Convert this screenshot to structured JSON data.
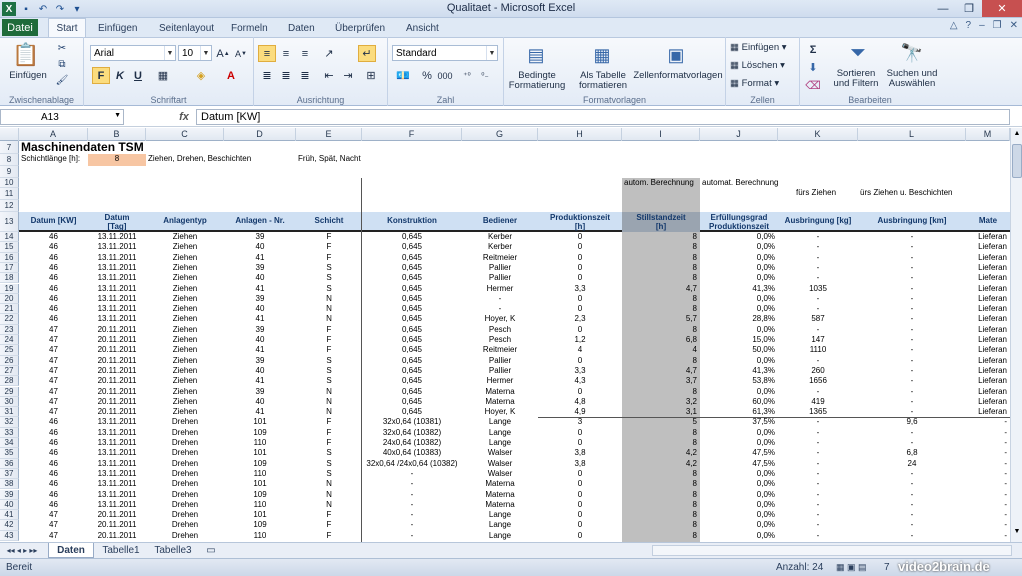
{
  "window": {
    "title": "Qualitaet - Microsoft Excel"
  },
  "tabs": {
    "file": "Datei",
    "start": "Start",
    "insert": "Einfügen",
    "layout": "Seitenlayout",
    "formulas": "Formeln",
    "data": "Daten",
    "review": "Überprüfen",
    "view": "Ansicht"
  },
  "ribbon": {
    "clipboard": {
      "paste": "Einfügen",
      "label": "Zwischenablage"
    },
    "font": {
      "name": "Arial",
      "size": "10",
      "label": "Schriftart",
      "bold": "F",
      "italic": "K",
      "underline": "U"
    },
    "alignment": {
      "label": "Ausrichtung"
    },
    "number": {
      "format": "Standard",
      "label": "Zahl",
      "percent": "%",
      "thousands": "000"
    },
    "styles": {
      "conditional1": "Bedingte",
      "conditional2": "Formatierung",
      "table1": "Als Tabelle",
      "table2": "formatieren",
      "cellstyles": "Zellenformatvorlagen",
      "label": "Formatvorlagen"
    },
    "cells": {
      "insert": "Einfügen",
      "delete": "Löschen",
      "format": "Format",
      "label": "Zellen"
    },
    "editing": {
      "sort1": "Sortieren",
      "sort2": "und Filtern",
      "find1": "Suchen und",
      "find2": "Auswählen",
      "label": "Bearbeiten"
    }
  },
  "formula": {
    "namebox": "A13",
    "fx": "fx",
    "value": "Datum [KW]"
  },
  "grid": {
    "columns": [
      "A",
      "B",
      "C",
      "D",
      "E",
      "F",
      "G",
      "H",
      "I",
      "J",
      "K",
      "L",
      "M"
    ],
    "row7": {
      "num": "7",
      "title": "Maschinendaten TSM"
    },
    "row8": {
      "num": "8",
      "label": "Schichtlänge [h]:",
      "value": "8",
      "processes": "Ziehen, Drehen, Beschichten",
      "shifts": "Früh, Spät, Nacht"
    },
    "row9": {
      "num": "9"
    },
    "row10": {
      "num": "10",
      "i": "autom. Berechnung",
      "j": "automat. Berechnung"
    },
    "row11": {
      "num": "11",
      "k": "fürs Ziehen",
      "l": "ürs Ziehen u. Beschichten"
    },
    "row12": {
      "num": "12"
    },
    "row13": {
      "num": "13",
      "a": "Datum [KW]",
      "b1": "Datum",
      "b2": "[Tag]",
      "c": "Anlagentyp",
      "d": "Anlagen - Nr.",
      "e": "Schicht",
      "f": "Konstruktion",
      "g": "Bediener",
      "h1": "Produktionszeit",
      "h2": "[h]",
      "i1": "Stillstandzeit",
      "i2": "[h]",
      "j1": "Erfüllungsgrad",
      "j2": "Produktionszeit",
      "k": "Ausbringung [kg]",
      "l": "Ausbringung [km]",
      "m": "Mate"
    },
    "rows": [
      [
        "14",
        "46",
        "13.11.2011",
        "Ziehen",
        "39",
        "F",
        "0,645",
        "Kerber",
        "0",
        "8",
        "0,0%",
        "-",
        "-",
        "Lieferan"
      ],
      [
        "15",
        "46",
        "13.11.2011",
        "Ziehen",
        "40",
        "F",
        "0,645",
        "Kerber",
        "0",
        "8",
        "0,0%",
        "-",
        "-",
        "Lieferan"
      ],
      [
        "16",
        "46",
        "13.11.2011",
        "Ziehen",
        "41",
        "F",
        "0,645",
        "Reitmeier",
        "0",
        "8",
        "0,0%",
        "-",
        "-",
        "Lieferan"
      ],
      [
        "17",
        "46",
        "13.11.2011",
        "Ziehen",
        "39",
        "S",
        "0,645",
        "Pallier",
        "0",
        "8",
        "0,0%",
        "-",
        "-",
        "Lieferan"
      ],
      [
        "18",
        "46",
        "13.11.2011",
        "Ziehen",
        "40",
        "S",
        "0,645",
        "Pallier",
        "0",
        "8",
        "0,0%",
        "-",
        "-",
        "Lieferan"
      ],
      [
        "19",
        "46",
        "13.11.2011",
        "Ziehen",
        "41",
        "S",
        "0,645",
        "Hermer",
        "3,3",
        "4,7",
        "41,3%",
        "1035",
        "-",
        "Lieferan"
      ],
      [
        "20",
        "46",
        "13.11.2011",
        "Ziehen",
        "39",
        "N",
        "0,645",
        "-",
        "0",
        "8",
        "0,0%",
        "-",
        "-",
        "Lieferan"
      ],
      [
        "21",
        "46",
        "13.11.2011",
        "Ziehen",
        "40",
        "N",
        "0,645",
        "-",
        "0",
        "8",
        "0,0%",
        "-",
        "-",
        "Lieferan"
      ],
      [
        "22",
        "46",
        "13.11.2011",
        "Ziehen",
        "41",
        "N",
        "0,645",
        "Hoyer, K",
        "2,3",
        "5,7",
        "28,8%",
        "587",
        "-",
        "Lieferan"
      ],
      [
        "23",
        "47",
        "20.11.2011",
        "Ziehen",
        "39",
        "F",
        "0,645",
        "Pesch",
        "0",
        "8",
        "0,0%",
        "-",
        "-",
        "Lieferan"
      ],
      [
        "24",
        "47",
        "20.11.2011",
        "Ziehen",
        "40",
        "F",
        "0,645",
        "Pesch",
        "1,2",
        "6,8",
        "15,0%",
        "147",
        "-",
        "Lieferan"
      ],
      [
        "25",
        "47",
        "20.11.2011",
        "Ziehen",
        "41",
        "F",
        "0,645",
        "Reitmeier",
        "4",
        "4",
        "50,0%",
        "1110",
        "-",
        "Lieferan"
      ],
      [
        "26",
        "47",
        "20.11.2011",
        "Ziehen",
        "39",
        "S",
        "0,645",
        "Pallier",
        "0",
        "8",
        "0,0%",
        "-",
        "-",
        "Lieferan"
      ],
      [
        "27",
        "47",
        "20.11.2011",
        "Ziehen",
        "40",
        "S",
        "0,645",
        "Pallier",
        "3,3",
        "4,7",
        "41,3%",
        "260",
        "-",
        "Lieferan"
      ],
      [
        "28",
        "47",
        "20.11.2011",
        "Ziehen",
        "41",
        "S",
        "0,645",
        "Hermer",
        "4,3",
        "3,7",
        "53,8%",
        "1656",
        "-",
        "Lieferan"
      ],
      [
        "29",
        "47",
        "20.11.2011",
        "Ziehen",
        "39",
        "N",
        "0,645",
        "Materna",
        "0",
        "8",
        "0,0%",
        "-",
        "-",
        "Lieferan"
      ],
      [
        "30",
        "47",
        "20.11.2011",
        "Ziehen",
        "40",
        "N",
        "0,645",
        "Materna",
        "4,8",
        "3,2",
        "60,0%",
        "419",
        "-",
        "Lieferan"
      ],
      [
        "31",
        "47",
        "20.11.2011",
        "Ziehen",
        "41",
        "N",
        "0,645",
        "Hoyer, K",
        "4,9",
        "3,1",
        "61,3%",
        "1365",
        "-",
        "Lieferan"
      ],
      [
        "32",
        "46",
        "13.11.2011",
        "Drehen",
        "101",
        "F",
        "32x0,64 (10381)",
        "Lange",
        "3",
        "5",
        "37,5%",
        "-",
        "9,6",
        "-"
      ],
      [
        "33",
        "46",
        "13.11.2011",
        "Drehen",
        "109",
        "F",
        "32x0,64 (10382)",
        "Lange",
        "0",
        "8",
        "0,0%",
        "-",
        "-",
        "-"
      ],
      [
        "34",
        "46",
        "13.11.2011",
        "Drehen",
        "110",
        "F",
        "24x0,64 (10382)",
        "Lange",
        "0",
        "8",
        "0,0%",
        "-",
        "-",
        "-"
      ],
      [
        "35",
        "46",
        "13.11.2011",
        "Drehen",
        "101",
        "S",
        "40x0,64 (10383)",
        "Walser",
        "3,8",
        "4,2",
        "47,5%",
        "-",
        "6,8",
        "-"
      ],
      [
        "36",
        "46",
        "13.11.2011",
        "Drehen",
        "109",
        "S",
        "32x0,64 /24x0,64 (10382)",
        "Walser",
        "3,8",
        "4,2",
        "47,5%",
        "-",
        "24",
        "-"
      ],
      [
        "37",
        "46",
        "13.11.2011",
        "Drehen",
        "110",
        "S",
        "-",
        "Walser",
        "0",
        "8",
        "0,0%",
        "-",
        "-",
        "-"
      ],
      [
        "38",
        "46",
        "13.11.2011",
        "Drehen",
        "101",
        "N",
        "-",
        "Materna",
        "0",
        "8",
        "0,0%",
        "-",
        "-",
        "-"
      ],
      [
        "39",
        "46",
        "13.11.2011",
        "Drehen",
        "109",
        "N",
        "-",
        "Materna",
        "0",
        "8",
        "0,0%",
        "-",
        "-",
        "-"
      ],
      [
        "40",
        "46",
        "13.11.2011",
        "Drehen",
        "110",
        "N",
        "-",
        "Materna",
        "0",
        "8",
        "0,0%",
        "-",
        "-",
        "-"
      ],
      [
        "41",
        "47",
        "20.11.2011",
        "Drehen",
        "101",
        "F",
        "-",
        "Lange",
        "0",
        "8",
        "0,0%",
        "-",
        "-",
        "-"
      ],
      [
        "42",
        "47",
        "20.11.2011",
        "Drehen",
        "109",
        "F",
        "-",
        "Lange",
        "0",
        "8",
        "0,0%",
        "-",
        "-",
        "-"
      ],
      [
        "43",
        "47",
        "20.11.2011",
        "Drehen",
        "110",
        "F",
        "-",
        "Lange",
        "0",
        "8",
        "0,0%",
        "-",
        "-",
        "-"
      ]
    ]
  },
  "sheets": {
    "s1": "Daten",
    "s2": "Tabelle1",
    "s3": "Tabelle3"
  },
  "status": {
    "mode": "Bereit",
    "count": "Anzahl: 24",
    "zoom": "7",
    "watermark": "video2brain.de"
  }
}
